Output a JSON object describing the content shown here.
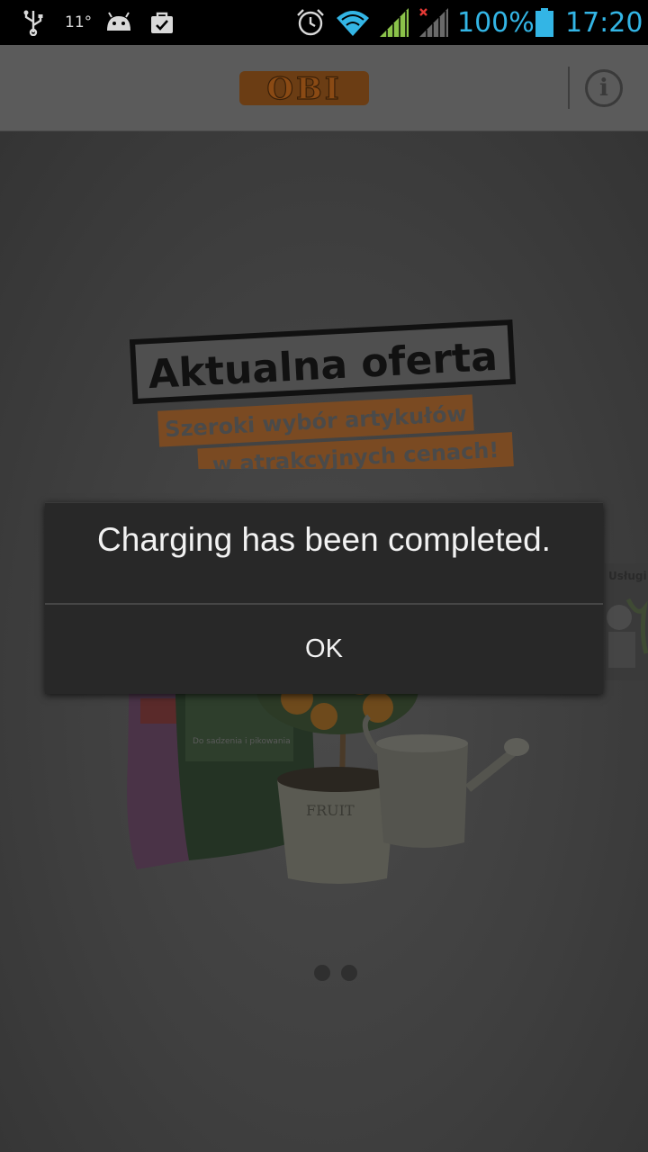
{
  "status_bar": {
    "temperature": "11°",
    "battery_percent": "100%",
    "clock": "17:20",
    "icons": [
      "usb-icon",
      "android-icon",
      "shopping-bag-icon",
      "alarm-icon",
      "wifi-icon",
      "signal-icon",
      "signal-no-data-icon",
      "battery-icon"
    ],
    "accent_color": "#33b5e5"
  },
  "header": {
    "logo_text": "OBI",
    "info_label": "i",
    "brand_color": "#e8721c"
  },
  "banner": {
    "title": "Aktualna oferta",
    "line1": "Szeroki wybór artykułów",
    "line2": "w atrakcyjnych cenach!"
  },
  "product_image": {
    "bag_label": "Do sadzenia i pikowania",
    "pot_label": "FRUIT"
  },
  "next_slide": {
    "label": "Usługi"
  },
  "dialog": {
    "message": "Charging has been completed.",
    "ok_label": "OK"
  },
  "pager": {
    "count": 2,
    "active": 0
  }
}
